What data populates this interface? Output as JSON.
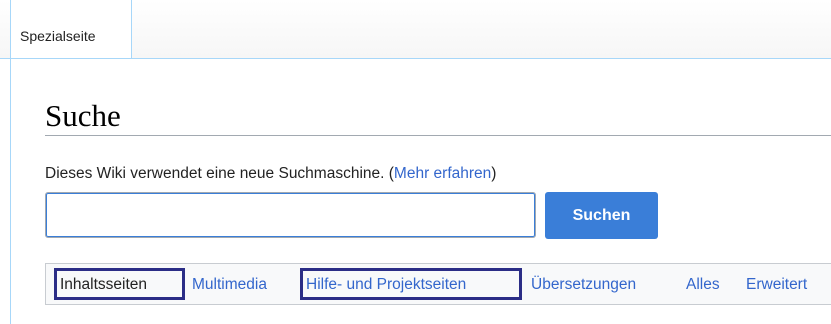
{
  "tabs": {
    "active_label": "Spezialseite"
  },
  "page": {
    "title": "Suche"
  },
  "notice": {
    "text": "Dieses Wiki verwendet eine neue Suchmaschine. (",
    "link": "Mehr erfahren",
    "suffix": ")"
  },
  "search": {
    "value": "",
    "button_label": "Suchen"
  },
  "filters": {
    "items": [
      {
        "label": "Inhaltsseiten",
        "active": true
      },
      {
        "label": "Multimedia",
        "active": false
      },
      {
        "label": "Hilfe- und Projektseiten",
        "active": false
      },
      {
        "label": "Übersetzungen",
        "active": false
      },
      {
        "label": "Alles",
        "active": false
      },
      {
        "label": "Erweitert",
        "active": false
      }
    ]
  },
  "colors": {
    "link": "#3366cc",
    "button": "#3a7ed8",
    "highlight_box": "#2b2d86"
  }
}
